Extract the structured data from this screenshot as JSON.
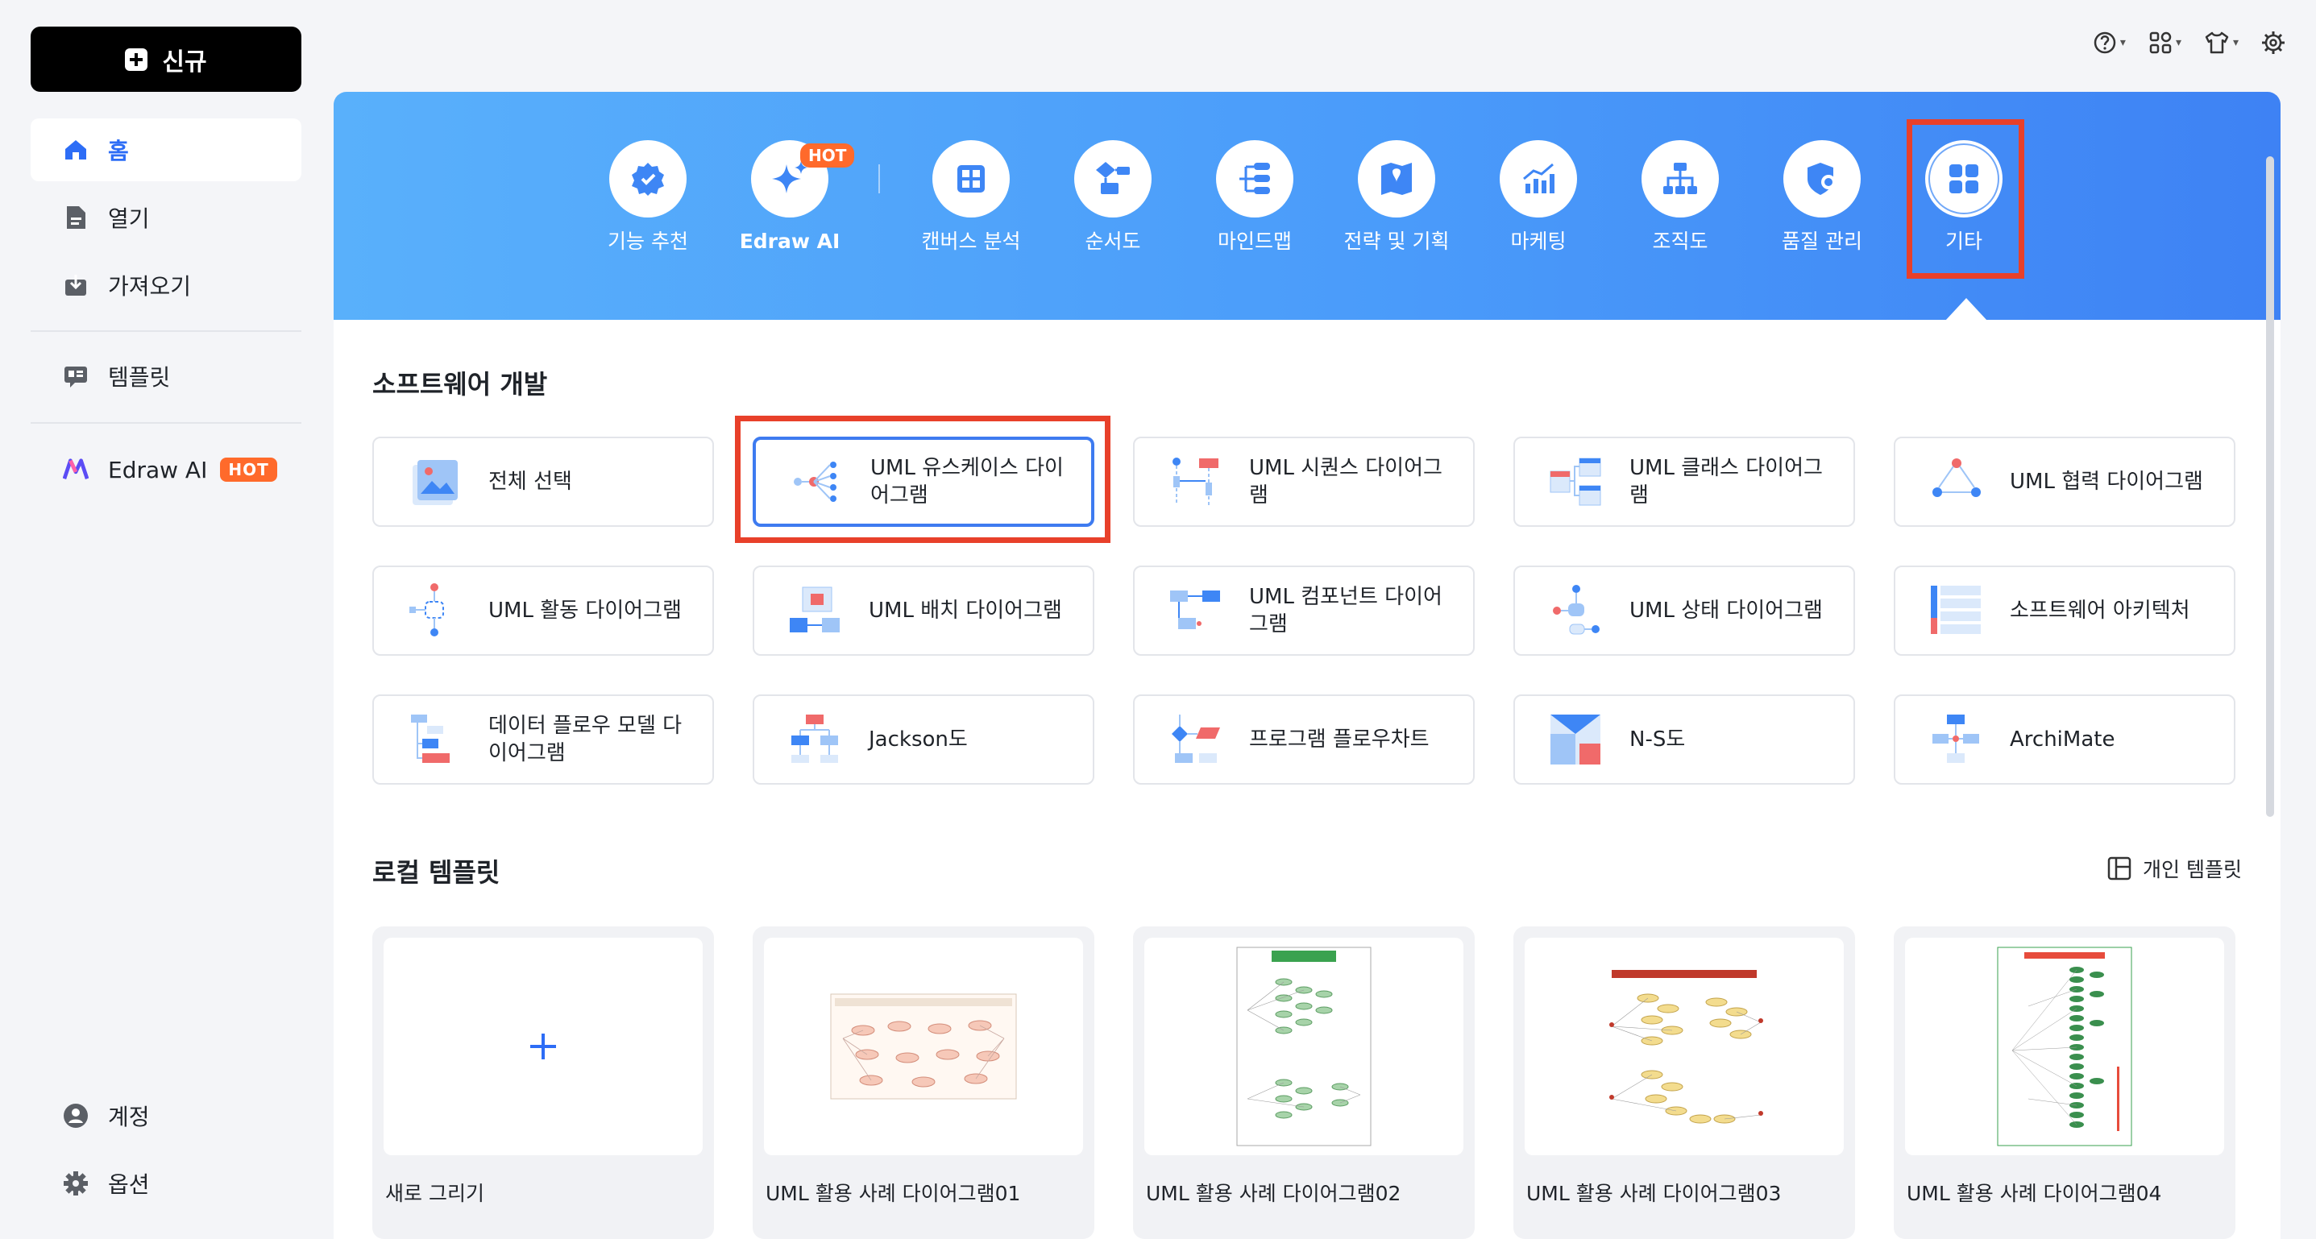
{
  "sidebar": {
    "new_label": "신규",
    "items": [
      {
        "label": "홈",
        "icon": "home-icon"
      },
      {
        "label": "열기",
        "icon": "document-icon"
      },
      {
        "label": "가져오기",
        "icon": "import-icon"
      },
      {
        "label": "템플릿",
        "icon": "template-icon"
      },
      {
        "label": "Edraw AI",
        "icon": "edraw-ai-logo-icon",
        "badge": "HOT"
      },
      {
        "label": "계정",
        "icon": "account-icon"
      },
      {
        "label": "옵션",
        "icon": "gear-icon"
      }
    ]
  },
  "categories": [
    {
      "label": "기능 추천",
      "icon": "badge-star-icon"
    },
    {
      "label": "Edraw AI",
      "icon": "sparkle-icon",
      "badge": "HOT"
    },
    {
      "label": "캔버스 분석",
      "icon": "grid-icon"
    },
    {
      "label": "순서도",
      "icon": "flowchart-icon"
    },
    {
      "label": "마인드맵",
      "icon": "mindmap-icon"
    },
    {
      "label": "전략 및 기획",
      "icon": "map-icon"
    },
    {
      "label": "마케팅",
      "icon": "bar-chart-icon"
    },
    {
      "label": "조직도",
      "icon": "org-chart-icon"
    },
    {
      "label": "품질 관리",
      "icon": "shield-gear-icon"
    },
    {
      "label": "기타",
      "icon": "apps-icon"
    }
  ],
  "software_section": {
    "title": "소프트웨어 개발",
    "templates": [
      "전체 선택",
      "UML 유스케이스 다이어그램",
      "UML 시퀀스 다이어그램",
      "UML 클래스 다이어그램",
      "UML 협력 다이어그램",
      "UML 활동 다이어그램",
      "UML 배치 다이어그램",
      "UML 컴포넌트 다이어그램",
      "UML 상태 다이어그램",
      "소프트웨어 아키텍처",
      "데이터 플로우 모델 다이어그램",
      "Jackson도",
      "프로그램 플로우차트",
      "N-S도",
      "ArchiMate"
    ]
  },
  "local_section": {
    "title": "로컬 템플릿",
    "personal_link": "개인 템플릿",
    "cards": [
      "새로 그리기",
      "UML 활용 사례 다이어그램01",
      "UML 활용 사례 다이어그램02",
      "UML 활용 사례 다이어그램03",
      "UML 활용 사례 다이어그램04"
    ]
  },
  "colors": {
    "accent": "#2d6df6",
    "hot": "#ff6a2b",
    "highlight": "#e8402a",
    "banner": "#4a9bfa"
  }
}
